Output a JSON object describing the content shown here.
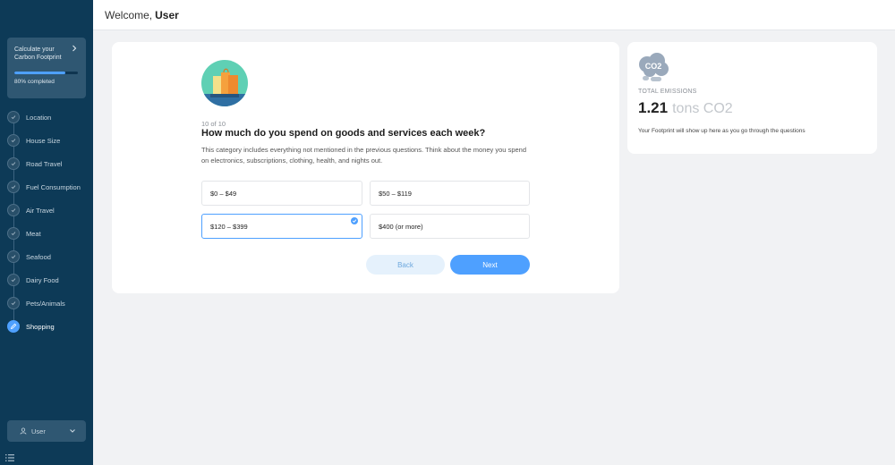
{
  "sidebar": {
    "progress": {
      "title": "Calculate your Carbon Footprint",
      "percent_label": "80% completed",
      "fraction": 0.8,
      "accent": "#4ea0ff"
    },
    "nav": [
      {
        "label": "Location",
        "icon": "check-icon",
        "active": false
      },
      {
        "label": "House Size",
        "icon": "check-icon",
        "active": false
      },
      {
        "label": "Road Travel",
        "icon": "check-icon",
        "active": false
      },
      {
        "label": "Fuel Consumption",
        "icon": "check-icon",
        "active": false
      },
      {
        "label": "Air Travel",
        "icon": "check-icon",
        "active": false
      },
      {
        "label": "Meat",
        "icon": "check-icon",
        "active": false
      },
      {
        "label": "Seafood",
        "icon": "check-icon",
        "active": false
      },
      {
        "label": "Dairy Food",
        "icon": "check-icon",
        "active": false
      },
      {
        "label": "Pets/Animals",
        "icon": "check-icon",
        "active": false
      },
      {
        "label": "Shopping",
        "icon": "pencil-icon",
        "active": true
      }
    ],
    "user_label": "User"
  },
  "header": {
    "greeting": "Welcome,",
    "username": "User"
  },
  "question": {
    "step": "10 of 10",
    "title": "How much do you spend on goods and services each week?",
    "description": "This category includes everything not mentioned in the previous questions. Think about the money you spend on electronics, subscriptions, clothing, health, and nights out.",
    "options": [
      {
        "label": "$0 – $49",
        "selected": false
      },
      {
        "label": "$50 – $119",
        "selected": false
      },
      {
        "label": "$120 – $399",
        "selected": true
      },
      {
        "label": "$400 (or more)",
        "selected": false
      }
    ],
    "back_label": "Back",
    "next_label": "Next"
  },
  "emissions": {
    "icon_text": "CO2",
    "label": "TOTAL EMISSIONS",
    "value": "1.21",
    "unit": "tons CO2",
    "note": "Your Footprint will show up here as you go through the questions"
  }
}
